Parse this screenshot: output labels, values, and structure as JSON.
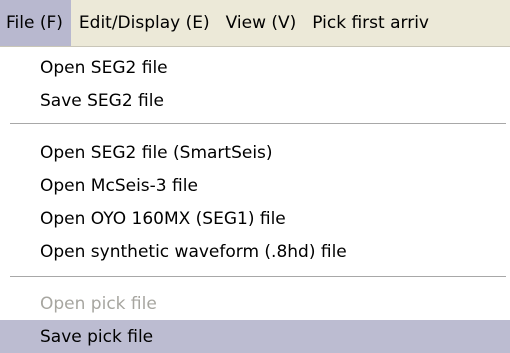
{
  "menubar": {
    "items": [
      {
        "label": "File (F)"
      },
      {
        "label": "Edit/Display (E)"
      },
      {
        "label": "View (V)"
      },
      {
        "label": "Pick first arriv"
      }
    ]
  },
  "file_menu": {
    "items": [
      {
        "label": "Open SEG2 file",
        "enabled": true
      },
      {
        "label": "Save SEG2 file",
        "enabled": true
      },
      {
        "label": "Open SEG2 file (SmartSeis)",
        "enabled": true
      },
      {
        "label": "Open McSeis-3 file",
        "enabled": true
      },
      {
        "label": "Open OYO 160MX (SEG1) file",
        "enabled": true
      },
      {
        "label": "Open synthetic waveform (.8hd) file",
        "enabled": true
      },
      {
        "label": "Open pick file",
        "enabled": false
      },
      {
        "label": "Save pick file",
        "enabled": true,
        "highlighted": true
      }
    ]
  },
  "colors": {
    "menubar_bg": "#ece9d8",
    "active_menu_bg": "#b8b8cf",
    "highlight_bg": "#bcbcd1",
    "disabled_text": "#a7a6a0"
  }
}
